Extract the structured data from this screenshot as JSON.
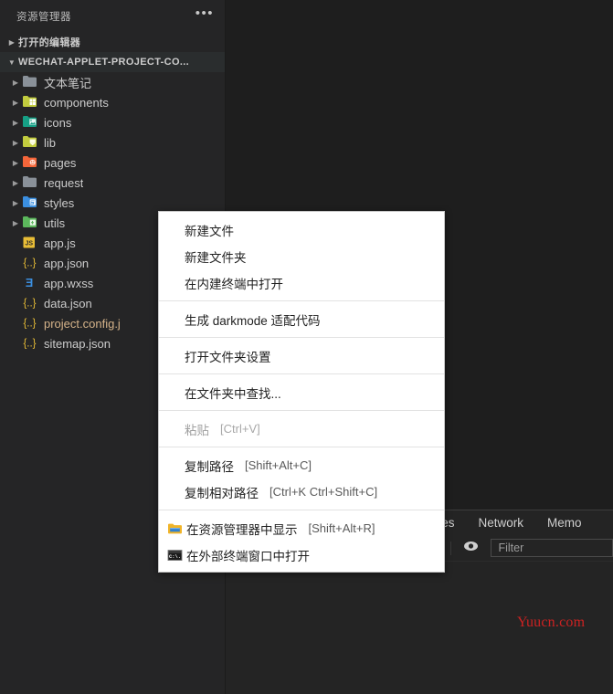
{
  "sidebar": {
    "title": "资源管理器",
    "more_icon": "ellipsis-icon",
    "sections": [
      {
        "label": "打开的编辑器",
        "expanded": false
      },
      {
        "label": "WECHAT-APPLET-PROJECT-CO...",
        "expanded": true
      }
    ],
    "folders": [
      {
        "label": "文本笔记",
        "icon": "folder-grey-icon",
        "color": "#8a9199"
      },
      {
        "label": "components",
        "icon": "folder-components-icon",
        "color": "#c2cc3e"
      },
      {
        "label": "icons",
        "icon": "folder-images-icon",
        "color": "#16a085"
      },
      {
        "label": "lib",
        "icon": "folder-lib-icon",
        "color": "#c2cc3e"
      },
      {
        "label": "pages",
        "icon": "folder-pages-icon",
        "color": "#f4663a"
      },
      {
        "label": "request",
        "icon": "folder-grey-icon",
        "color": "#8a9199"
      },
      {
        "label": "styles",
        "icon": "folder-css-icon",
        "color": "#3b8fe0"
      },
      {
        "label": "utils",
        "icon": "folder-utils-icon",
        "color": "#5cb85c"
      }
    ],
    "files": [
      {
        "label": "app.js",
        "icon": "js-file-icon",
        "kind": "js"
      },
      {
        "label": "app.json",
        "icon": "json-file-icon",
        "kind": "json"
      },
      {
        "label": "app.wxss",
        "icon": "wxss-file-icon",
        "kind": "wxss"
      },
      {
        "label": "data.json",
        "icon": "json-file-icon",
        "kind": "json"
      },
      {
        "label": "project.config.j",
        "icon": "json-file-icon",
        "kind": "cfg"
      },
      {
        "label": "sitemap.json",
        "icon": "json-file-icon",
        "kind": "json"
      }
    ]
  },
  "context_menu": {
    "groups": [
      {
        "items": [
          {
            "label": "新建文件",
            "shortcut": "",
            "disabled": false,
            "icon": ""
          },
          {
            "label": "新建文件夹",
            "shortcut": "",
            "disabled": false,
            "icon": ""
          },
          {
            "label": "在内建终端中打开",
            "shortcut": "",
            "disabled": false,
            "icon": ""
          }
        ]
      },
      {
        "items": [
          {
            "label": "生成 darkmode 适配代码",
            "shortcut": "",
            "disabled": false,
            "icon": ""
          }
        ]
      },
      {
        "items": [
          {
            "label": "打开文件夹设置",
            "shortcut": "",
            "disabled": false,
            "icon": ""
          }
        ]
      },
      {
        "items": [
          {
            "label": "在文件夹中查找...",
            "shortcut": "",
            "disabled": false,
            "icon": ""
          }
        ]
      },
      {
        "items": [
          {
            "label": "粘贴",
            "shortcut": "[Ctrl+V]",
            "disabled": true,
            "icon": ""
          }
        ]
      },
      {
        "items": [
          {
            "label": "复制路径",
            "shortcut": "[Shift+Alt+C]",
            "disabled": false,
            "icon": ""
          },
          {
            "label": "复制相对路径",
            "shortcut": "[Ctrl+K Ctrl+Shift+C]",
            "disabled": false,
            "icon": ""
          }
        ]
      },
      {
        "items": [
          {
            "label": "在资源管理器中显示",
            "shortcut": "[Shift+Alt+R]",
            "disabled": false,
            "icon": "windows-folder-icon"
          },
          {
            "label": "在外部终端窗口中打开",
            "shortcut": "",
            "disabled": false,
            "icon": "cmd-console-icon"
          }
        ]
      }
    ]
  },
  "devtools": {
    "tabs": [
      "rces",
      "Network",
      "Memo"
    ],
    "toolbar": {
      "dropdown_icon": "chevron-down-icon",
      "eye_icon": "eye-icon",
      "filter_placeholder": "Filter"
    }
  },
  "watermark": {
    "text": "Yuucn.com",
    "color": "#cc2222"
  }
}
